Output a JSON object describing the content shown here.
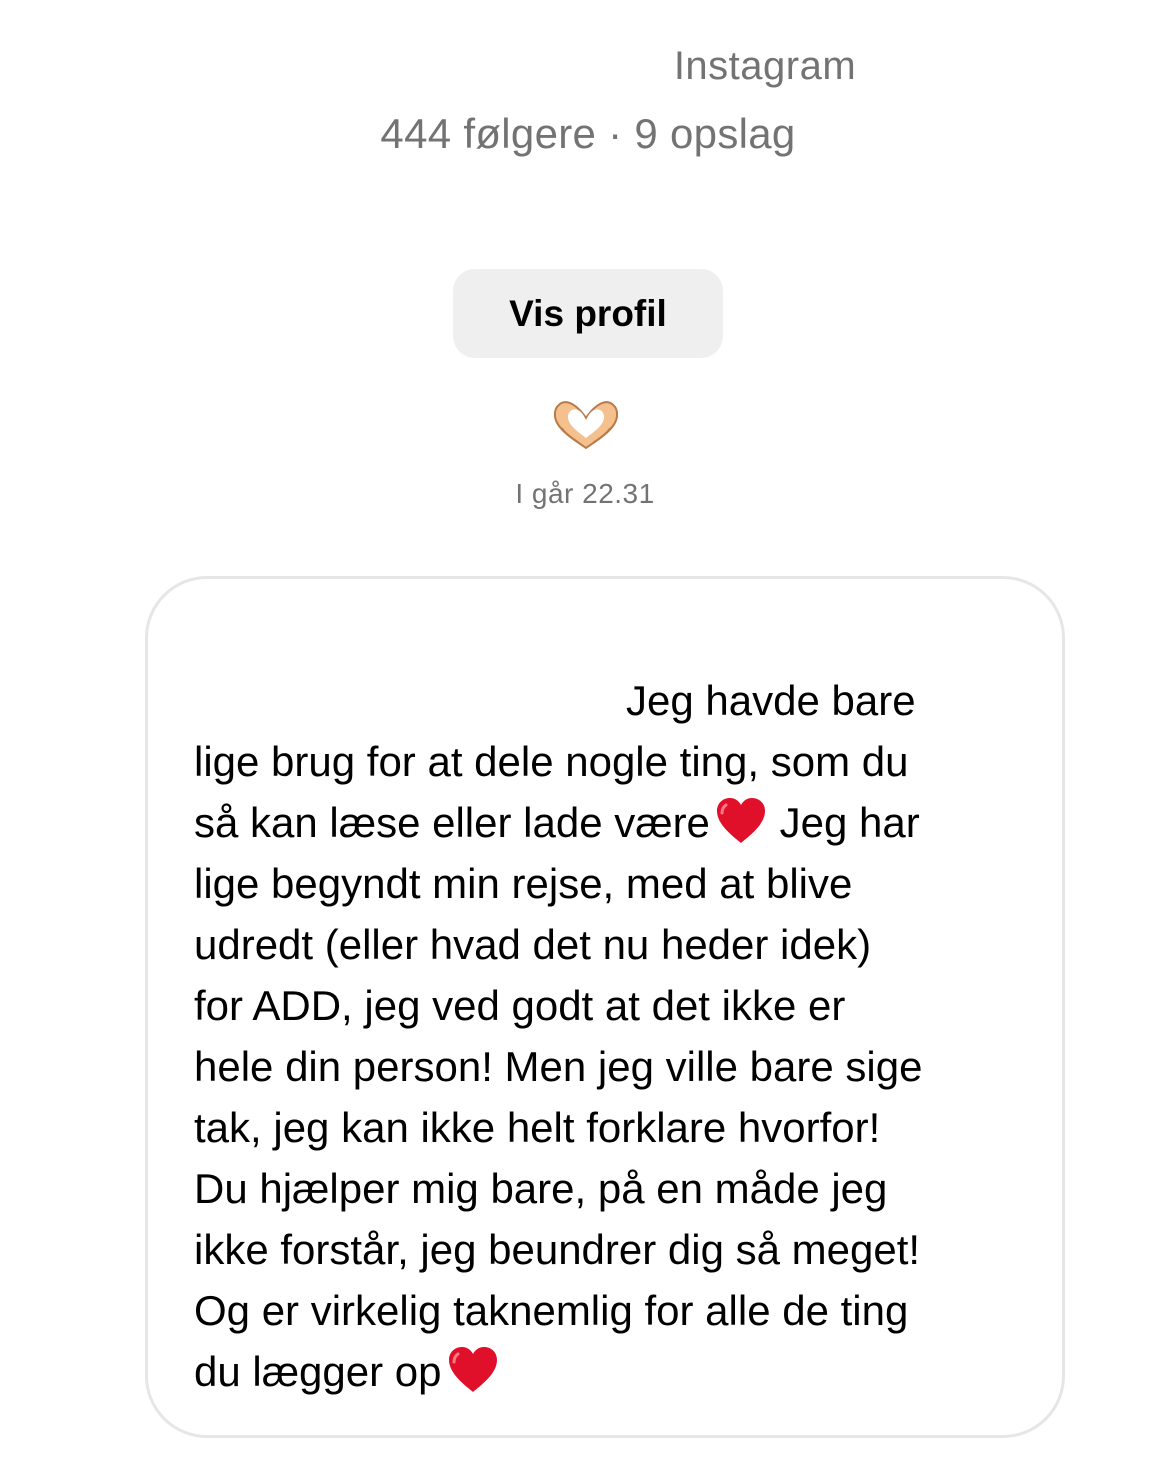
{
  "header": {
    "platform_label": "Instagram",
    "profile_stats": "444 følgere · 9 opslag"
  },
  "actions": {
    "view_profile_label": "Vis profil"
  },
  "reaction": {
    "icon": "heart-hands-emoji"
  },
  "conversation": {
    "timestamp": "I går 22.31"
  },
  "message": {
    "lines": [
      "Jeg havde bare",
      "lige brug for at dele nogle ting, som du",
      "så kan læse eller lade være",
      " Jeg har",
      "lige begyndt min rejse, med at blive",
      "udredt (eller hvad det nu heder idek)",
      "for ADD, jeg ved godt at det ikke er",
      "hele din person! Men jeg ville bare sige",
      "tak, jeg kan ikke helt forklare hvorfor!",
      "Du hjælper mig bare, på en måde jeg",
      "ikke forstår, jeg beundrer dig så meget!",
      "Og er virkelig taknemlig for alle de ting",
      "du lægger op"
    ],
    "emoji": "red-heart-emoji",
    "emoji_color": "#e0102a"
  },
  "colors": {
    "secondary_text": "#737373",
    "button_background": "#efefef",
    "bubble_border": "#e6e6e6"
  }
}
